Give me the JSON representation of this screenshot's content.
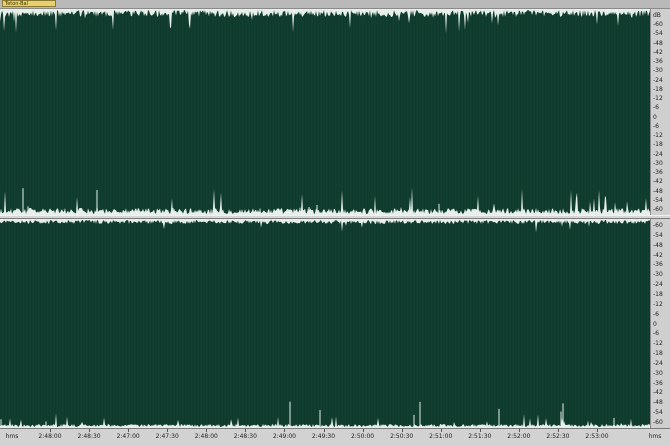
{
  "window": {
    "file_tab_label": "Teton-Bal"
  },
  "channels": [
    {
      "name": "top",
      "scale_labels": [
        "dB",
        "-60",
        "-54",
        "-48",
        "-42",
        "-36",
        "-30",
        "-24",
        "-18",
        "-12",
        "-6",
        "0",
        "-6",
        "-12",
        "-18",
        "-24",
        "-30",
        "-36",
        "-42",
        "-48",
        "-54",
        "-60"
      ]
    },
    {
      "name": "bottom",
      "scale_labels": [
        "-60",
        "-54",
        "-48",
        "-42",
        "-36",
        "-30",
        "-24",
        "-18",
        "-12",
        "-6",
        "0",
        "-6",
        "-12",
        "-18",
        "-24",
        "-30",
        "-36",
        "-42",
        "-48",
        "-54",
        "-60"
      ]
    }
  ],
  "ruler": {
    "start_label": "hms",
    "end_label": "hms",
    "labels": [
      "2:48:00",
      "2:48:30",
      "2:47:00",
      "2:47:30",
      "2:48:00",
      "2:48:30",
      "2:49:00",
      "2:49:30",
      "2:50:00",
      "2:50:30",
      "2:51:00",
      "2:51:30",
      "2:52:00",
      "2:52:30",
      "2:53:00"
    ]
  },
  "colors": {
    "waveform_bg": "#0f3a2c",
    "waveform_peaks": "#e6efe9",
    "grid": "#1c5040"
  }
}
